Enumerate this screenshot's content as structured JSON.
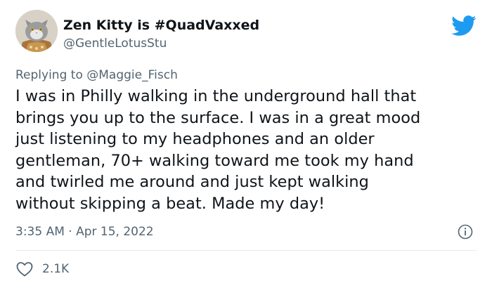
{
  "tweet": {
    "author_name": "Zen Kitty is #QuadVaxxed",
    "author_handle": "@GentleLotusStu",
    "replying_prefix": "Replying to ",
    "replying_to": "@Maggie_Fisch",
    "text": "I was in Philly walking in the underground hall that\nbrings you up to the surface. I was in a great mood\njust listening to my headphones and an older\ngentleman, 70+ walking toward me took my hand\nand twirled me around and just kept walking\nwithout skipping a beat. Made my day!",
    "time": "3:35 AM · Apr 15, 2022",
    "like_count": "2.1K"
  },
  "icons": {
    "platform": "twitter-bird-icon",
    "info": "info-icon",
    "like": "heart-icon",
    "avatar": "cat-avatar"
  },
  "colors": {
    "twitter_blue": "#1d9bf0",
    "secondary_text": "#536471",
    "primary_text": "#0f1419"
  }
}
